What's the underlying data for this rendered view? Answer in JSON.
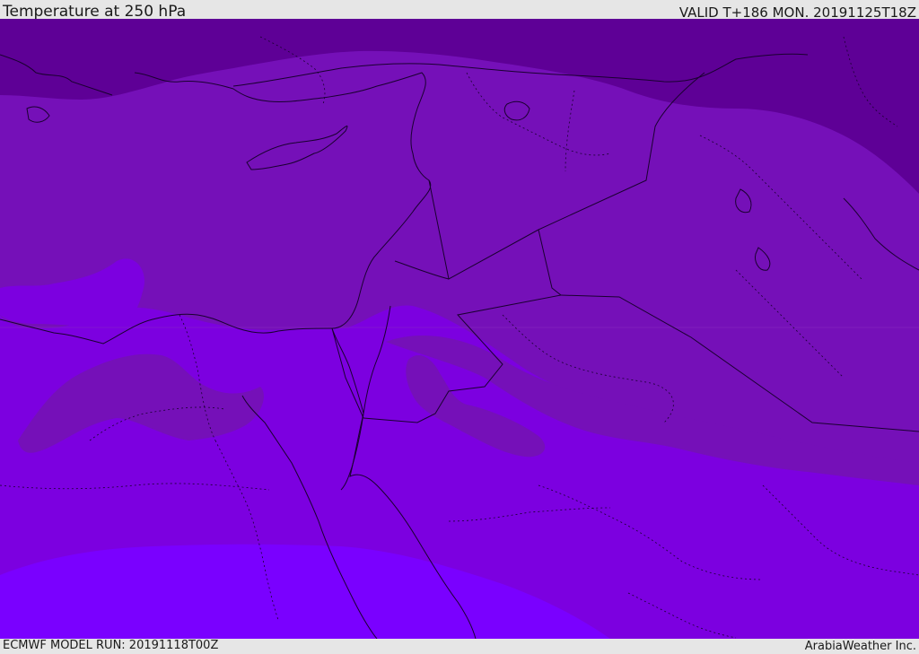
{
  "header": {
    "title": "Temperature at 250 hPa",
    "valid": "VALID T+186 MON. 20191125T18Z"
  },
  "footer": {
    "model_run": "ECMWF MODEL RUN: 20191118T00Z",
    "credit": "ArabiaWeather Inc."
  },
  "map": {
    "field": "temperature-250hPa",
    "colors": {
      "coldest_band": "#5e0096",
      "band_2": "#7510b8",
      "band_3": "#7c00e0",
      "warmest_band": "#7a00ff",
      "border_line": "#1a0030"
    }
  }
}
